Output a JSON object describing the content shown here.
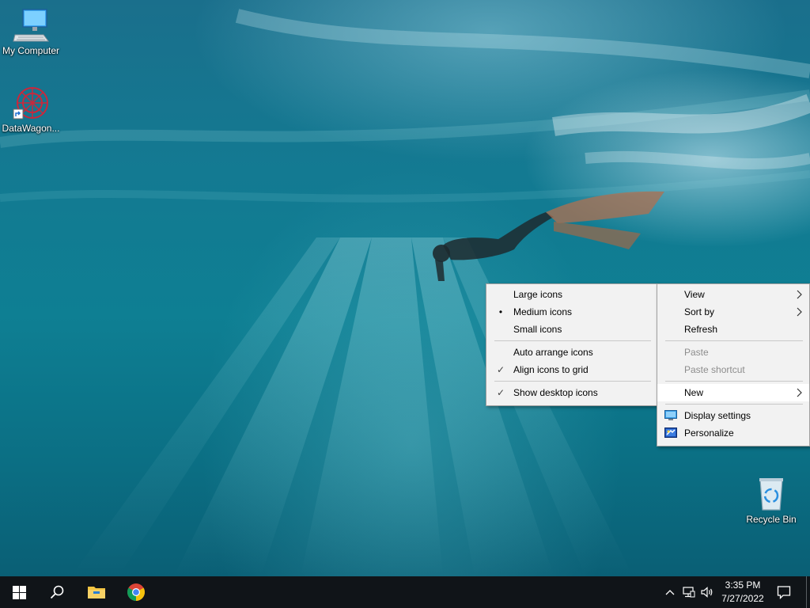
{
  "desktop": {
    "icons": [
      {
        "label": "My Computer",
        "icon": "computer-icon"
      },
      {
        "label": "DataWagon...",
        "icon": "datawagon-icon"
      },
      {
        "label": "Recycle Bin",
        "icon": "recycle-bin-icon"
      }
    ]
  },
  "context_menu": {
    "items": [
      {
        "label": "View",
        "submenu": true
      },
      {
        "label": "Sort by",
        "submenu": true
      },
      {
        "label": "Refresh"
      },
      {
        "label": "Paste",
        "disabled": true
      },
      {
        "label": "Paste shortcut",
        "disabled": true
      },
      {
        "label": "New",
        "submenu": true,
        "highlighted": true
      },
      {
        "label": "Display settings",
        "icon": "display-settings-icon"
      },
      {
        "label": "Personalize",
        "icon": "personalize-icon"
      }
    ]
  },
  "view_submenu": {
    "items": [
      {
        "label": "Large icons"
      },
      {
        "label": "Medium icons",
        "mark": "•"
      },
      {
        "label": "Small icons"
      },
      {
        "label": "Auto arrange icons"
      },
      {
        "label": "Align icons to grid",
        "mark": "✓"
      },
      {
        "label": "Show desktop icons",
        "mark": "✓"
      }
    ]
  },
  "taskbar": {
    "pinned": [
      "start-icon",
      "search-icon",
      "file-explorer-icon",
      "chrome-icon"
    ],
    "tray": [
      "chevron-up-icon",
      "network-icon",
      "volume-icon"
    ],
    "time": "3:35 PM",
    "date": "7/27/2022",
    "notification": "action-center-icon"
  },
  "colors": {
    "taskbar_bg": "#101418",
    "menu_bg": "#f2f2f2",
    "menu_highlight": "#ffffff"
  }
}
